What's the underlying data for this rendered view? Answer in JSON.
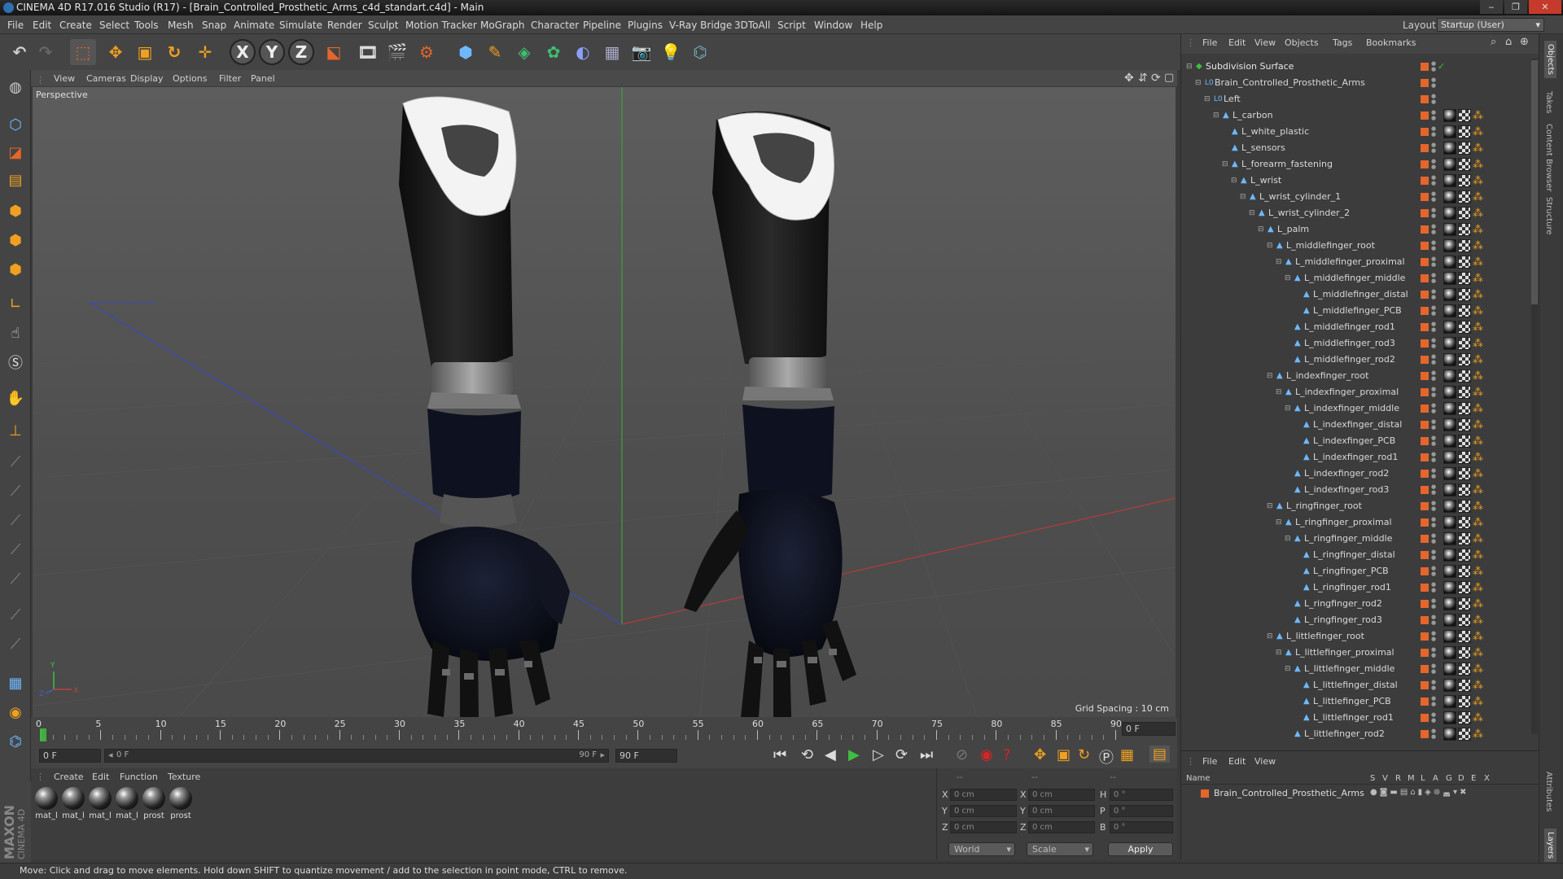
{
  "window": {
    "title": "CINEMA 4D R17.016 Studio (R17) - [Brain_Controlled_Prosthetic_Arms_c4d_standart.c4d] - Main",
    "controls": [
      "‒",
      "❐",
      "✕"
    ]
  },
  "menubar": {
    "items": [
      "File",
      "Edit",
      "Create",
      "Select",
      "Tools",
      "Mesh",
      "Snap",
      "Animate",
      "Simulate",
      "Render",
      "Sculpt",
      "Motion Tracker",
      "MoGraph",
      "Character",
      "Pipeline",
      "Plugins",
      "V-Ray Bridge",
      "3DToAll",
      "Script",
      "Window",
      "Help"
    ],
    "layout_label": "Layout:",
    "layout_value": "Startup (User)"
  },
  "toolbar": {
    "axis_labels": [
      "X",
      "Y",
      "Z"
    ]
  },
  "viewport": {
    "menu": [
      "View",
      "Cameras",
      "Display",
      "Options",
      "Filter",
      "Panel"
    ],
    "camera_label": "Perspective",
    "grid_spacing": "Grid Spacing : 10 cm",
    "axis_labels": {
      "x": "X",
      "y": "Y",
      "z": "Z"
    }
  },
  "timeline": {
    "ticks": [
      "0",
      "5",
      "10",
      "15",
      "20",
      "25",
      "30",
      "35",
      "40",
      "45",
      "50",
      "55",
      "60",
      "65",
      "70",
      "75",
      "80",
      "85",
      "90"
    ],
    "current_frame_field": "0 F",
    "start_field": "0 F",
    "range_start": "0 F",
    "range_end": "90 F",
    "end_field": "90 F",
    "playhead_frame": 0,
    "frame_max": 90
  },
  "materials": {
    "menu": [
      "Create",
      "Edit",
      "Function",
      "Texture"
    ],
    "items": [
      "mat_l",
      "mat_l",
      "mat_l",
      "mat_l",
      "prost",
      "prost"
    ]
  },
  "coordinates": {
    "header": [
      "--",
      "--",
      "--"
    ],
    "rows": [
      {
        "a": "X",
        "av": "0 cm",
        "b": "X",
        "bv": "0 cm",
        "c": "H",
        "cv": "0 °"
      },
      {
        "a": "Y",
        "av": "0 cm",
        "b": "Y",
        "bv": "0 cm",
        "c": "P",
        "cv": "0 °"
      },
      {
        "a": "Z",
        "av": "0 cm",
        "b": "Z",
        "bv": "0 cm",
        "c": "B",
        "cv": "0 °"
      }
    ],
    "mode": "World",
    "type": "Scale",
    "apply": "Apply"
  },
  "status": "Move: Click and drag to move elements. Hold down SHIFT to quantize movement / add to the selection in point mode, CTRL to remove.",
  "brand": {
    "line1": "MAXON",
    "line2": "CINEMA 4D"
  },
  "object_manager": {
    "menu": [
      "File",
      "Edit",
      "View",
      "Objects",
      "Tags",
      "Bookmarks"
    ],
    "objects": [
      {
        "name": "Subdivision Surface",
        "depth": 0,
        "kind": "subdiv"
      },
      {
        "name": "Brain_Controlled_Prosthetic_Arms",
        "depth": 1,
        "kind": "null"
      },
      {
        "name": "Left",
        "depth": 2,
        "kind": "null"
      },
      {
        "name": "L_carbon",
        "depth": 3,
        "kind": "bone"
      },
      {
        "name": "L_white_plastic",
        "depth": 4,
        "kind": "bone"
      },
      {
        "name": "L_sensors",
        "depth": 4,
        "kind": "bone"
      },
      {
        "name": "L_forearm_fastening",
        "depth": 4,
        "kind": "bone"
      },
      {
        "name": "L_wrist",
        "depth": 5,
        "kind": "bone"
      },
      {
        "name": "L_wrist_cylinder_1",
        "depth": 6,
        "kind": "bone"
      },
      {
        "name": "L_wrist_cylinder_2",
        "depth": 7,
        "kind": "bone"
      },
      {
        "name": "L_palm",
        "depth": 8,
        "kind": "bone"
      },
      {
        "name": "L_middlefinger_root",
        "depth": 9,
        "kind": "bone"
      },
      {
        "name": "L_middlefinger_proximal",
        "depth": 10,
        "kind": "bone"
      },
      {
        "name": "L_middlefinger_middle",
        "depth": 11,
        "kind": "bone"
      },
      {
        "name": "L_middlefinger_distal",
        "depth": 12,
        "kind": "bone"
      },
      {
        "name": "L_middlefinger_PCB",
        "depth": 12,
        "kind": "bone"
      },
      {
        "name": "L_middlefinger_rod1",
        "depth": 11,
        "kind": "bone"
      },
      {
        "name": "L_middlefinger_rod3",
        "depth": 11,
        "kind": "bone"
      },
      {
        "name": "L_middlefinger_rod2",
        "depth": 11,
        "kind": "bone"
      },
      {
        "name": "L_indexfinger_root",
        "depth": 9,
        "kind": "bone"
      },
      {
        "name": "L_indexfinger_proximal",
        "depth": 10,
        "kind": "bone"
      },
      {
        "name": "L_indexfinger_middle",
        "depth": 11,
        "kind": "bone"
      },
      {
        "name": "L_indexfinger_distal",
        "depth": 12,
        "kind": "bone"
      },
      {
        "name": "L_indexfinger_PCB",
        "depth": 12,
        "kind": "bone"
      },
      {
        "name": "L_indexfinger_rod1",
        "depth": 12,
        "kind": "bone"
      },
      {
        "name": "L_indexfinger_rod2",
        "depth": 11,
        "kind": "bone"
      },
      {
        "name": "L_indexfinger_rod3",
        "depth": 11,
        "kind": "bone"
      },
      {
        "name": "L_ringfinger_root",
        "depth": 9,
        "kind": "bone"
      },
      {
        "name": "L_ringfinger_proximal",
        "depth": 10,
        "kind": "bone"
      },
      {
        "name": "L_ringfinger_middle",
        "depth": 11,
        "kind": "bone"
      },
      {
        "name": "L_ringfinger_distal",
        "depth": 12,
        "kind": "bone"
      },
      {
        "name": "L_ringfinger_PCB",
        "depth": 12,
        "kind": "bone"
      },
      {
        "name": "L_ringfinger_rod1",
        "depth": 12,
        "kind": "bone"
      },
      {
        "name": "L_ringfinger_rod2",
        "depth": 11,
        "kind": "bone"
      },
      {
        "name": "L_ringfinger_rod3",
        "depth": 11,
        "kind": "bone"
      },
      {
        "name": "L_littlefinger_root",
        "depth": 9,
        "kind": "bone"
      },
      {
        "name": "L_littlefinger_proximal",
        "depth": 10,
        "kind": "bone"
      },
      {
        "name": "L_littlefinger_middle",
        "depth": 11,
        "kind": "bone"
      },
      {
        "name": "L_littlefinger_distal",
        "depth": 12,
        "kind": "bone"
      },
      {
        "name": "L_littlefinger_PCB",
        "depth": 12,
        "kind": "bone"
      },
      {
        "name": "L_littlefinger_rod1",
        "depth": 12,
        "kind": "bone"
      },
      {
        "name": "L_littlefinger_rod2",
        "depth": 11,
        "kind": "bone"
      }
    ]
  },
  "layer_manager": {
    "menu": [
      "File",
      "Edit",
      "View"
    ],
    "columns": [
      "Name",
      "S",
      "V",
      "R",
      "M",
      "L",
      "A",
      "G",
      "D",
      "E",
      "X"
    ],
    "layers": [
      {
        "name": "Brain_Controlled_Prosthetic_Arms",
        "color": "#e4662a"
      }
    ]
  },
  "right_tabs": [
    "Objects",
    "Takes",
    "Content Browser",
    "Structure",
    "Attributes",
    "Layers"
  ],
  "colors": {
    "accent_orange": "#e4662a",
    "blue_icon": "#6fb8ff",
    "play_green": "#3fbf3f",
    "record_red": "#d22"
  }
}
